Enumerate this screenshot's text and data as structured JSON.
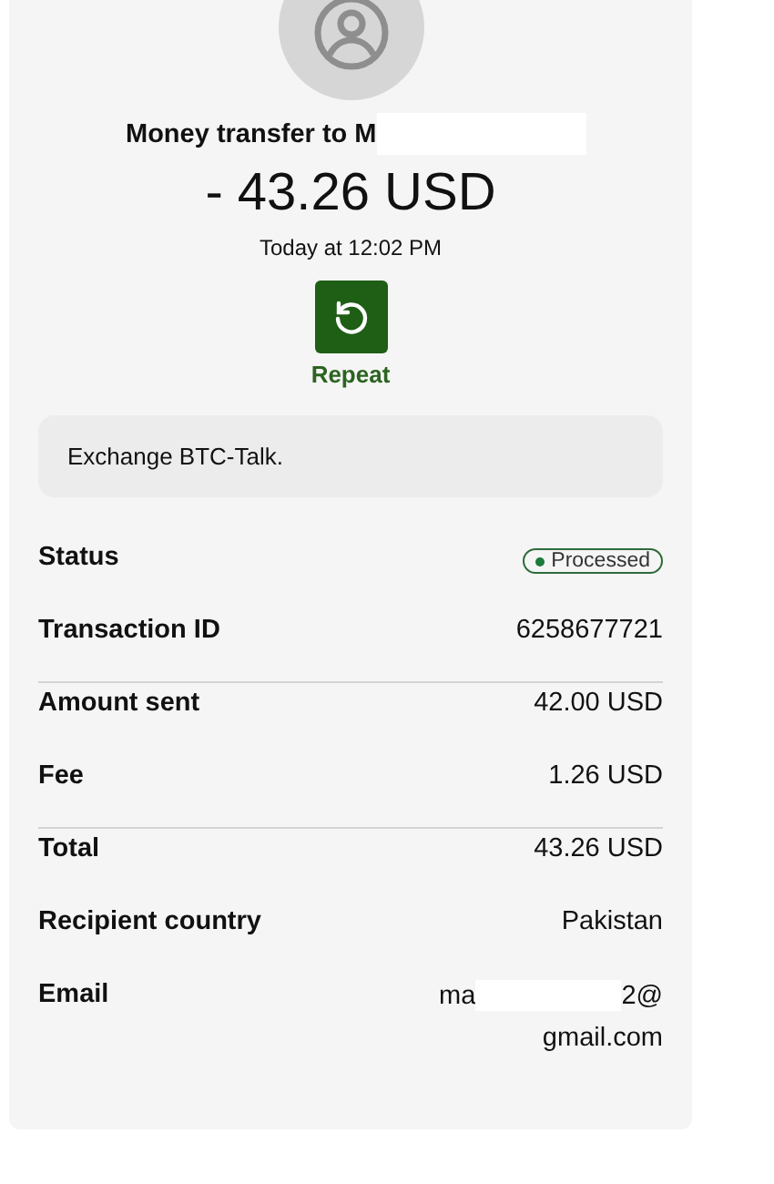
{
  "header": {
    "title": "Money transfer to M",
    "amount": "- 43.26 USD",
    "time": "Today at 12:02 PM"
  },
  "repeat_button": {
    "label": "Repeat"
  },
  "note": "Exchange BTC-Talk.",
  "details": [
    {
      "kind": "badge",
      "label": "Status",
      "value": "Processed",
      "color": "#1e7a3a",
      "divider_after": false
    },
    {
      "kind": "text",
      "label": "Transaction ID",
      "value": "6258677721",
      "divider_after": true
    },
    {
      "kind": "text",
      "label": "Amount sent",
      "value": "42.00 USD",
      "divider_after": false
    },
    {
      "kind": "text",
      "label": "Fee",
      "value": "1.26 USD",
      "divider_after": true
    },
    {
      "kind": "text",
      "label": "Total",
      "value": "43.26 USD",
      "divider_after": false
    },
    {
      "kind": "text",
      "label": "Recipient country",
      "value": "Pakistan",
      "divider_after": false
    },
    {
      "kind": "email",
      "label": "Email",
      "start": "ma",
      "end": "2@",
      "line2": "gmail.com",
      "divider_after": false
    }
  ]
}
